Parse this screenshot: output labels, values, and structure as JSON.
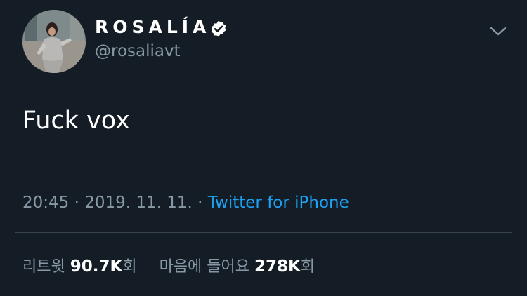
{
  "tweet": {
    "display_name": "ROSALÍA",
    "handle": "@rosaliavt",
    "text": "Fuck vox",
    "time": "20:45",
    "separator": "·",
    "date": "2019. 11. 11.",
    "source": "Twitter for iPhone"
  },
  "stats": {
    "retweets_label": "리트윗",
    "retweets_count": "90.7K",
    "retweets_suffix": "회",
    "likes_label": "마음에 들어요",
    "likes_count": "278K",
    "likes_suffix": "회"
  },
  "icons": {
    "verified": "verified-badge-icon",
    "menu": "chevron-down-icon"
  },
  "colors": {
    "background": "#141d26",
    "text": "#ffffff",
    "secondary": "#8899a6",
    "link": "#1da1f2",
    "divider": "#38444d"
  }
}
